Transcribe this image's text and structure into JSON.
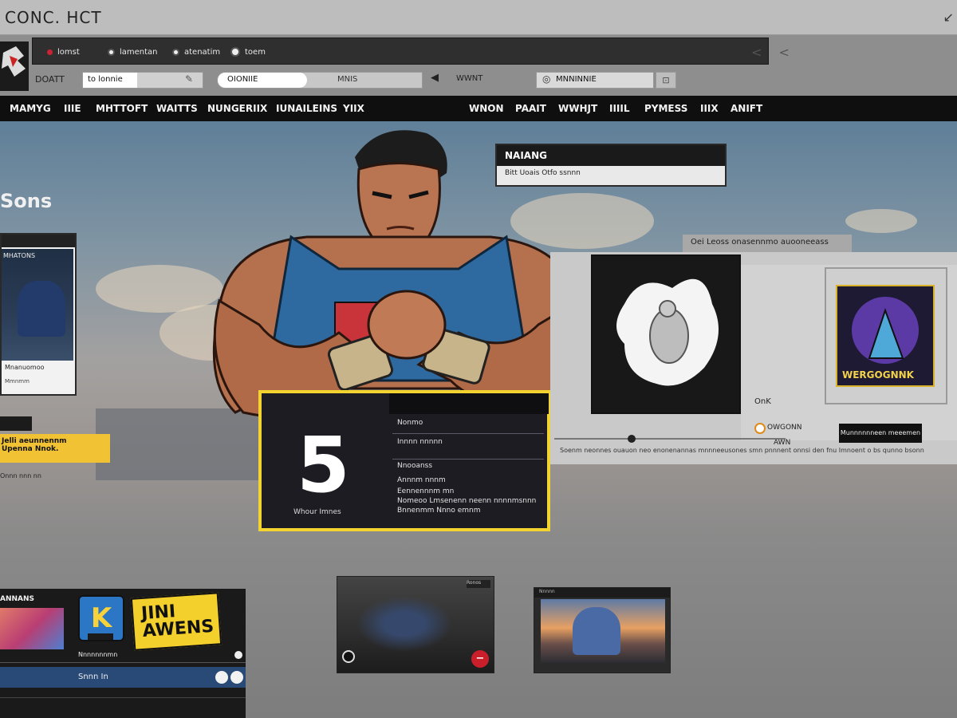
{
  "window": {
    "title": "CONC. HCT"
  },
  "toolbar1": {
    "items": [
      {
        "icon": "red-dot-icon",
        "label": "lomst"
      },
      {
        "icon": "radio-dot-icon",
        "label": "lamentan"
      },
      {
        "icon": "radio-dot-icon",
        "label": "atenatim"
      },
      {
        "icon": "radio-dot-icon",
        "label": "toem"
      }
    ],
    "nav": "< <"
  },
  "toolbar2": {
    "label": "DOATT",
    "field_a_value": "to lonnie",
    "field_b_value": "OIONIIE",
    "field_b_extra": "MNIS",
    "back_label": "WWNT",
    "search_value": "MNNINNIE"
  },
  "nav": {
    "items": [
      "MAMYG",
      "IIIE",
      "MHTTOFT",
      "WAITTS",
      "NUNGERIIX",
      "IUNAILEINS",
      "YIIX",
      "WNON",
      "PAAIT",
      "WWHJT",
      "IIIIL",
      "PYMESS",
      "IIIX",
      "ANIFT"
    ]
  },
  "hero": {
    "heading": "Sons",
    "left_card": {
      "title": "MHATONS",
      "name": "Mnanuomoo",
      "meta": "Mmnmm"
    },
    "yellow_tag": "Jelli aeunnennm\nUpenna Nnok.",
    "tag_meta": "Onnn nnn nn",
    "name_box": {
      "title": "NAIANG",
      "subtitle": "Bitt Uoais Otfo ssnnn"
    },
    "right_panel": {
      "caption": "Oei Leoss onasennmo auooneeass",
      "ok_label": "OnK",
      "option_label": "OWGONN",
      "option_sub": "AWN",
      "badge_text": "WERGOGNNK",
      "dark_button": "Munnnnnneen meeemen",
      "description": "Soenm neonnes ouauon neo enonenannas mnnneeusones  smn pnnnent onnsi den fnu Imnoent o bs qunno bsonn"
    },
    "stats": {
      "number": "5",
      "caption": "Whour Imnes",
      "lines": [
        "Nonmo",
        "Innnn nnnnn",
        "Nnooanss",
        "Annnm nnnm",
        "Eennennnm mn",
        "Nomeoo Lmsenenn neenn nnnnmsnnn",
        "Bnnenmm Nnno emnm"
      ]
    },
    "bottom_left": {
      "title": "ANNANS",
      "k_badge": "K",
      "jini_badge": "JINI AWENS",
      "subtitle": "Nnnnnnnmn",
      "bar_label": "Snnn In"
    },
    "video1": {
      "badge": "Ronos"
    },
    "video2": {
      "label": "Nnnnn"
    }
  }
}
